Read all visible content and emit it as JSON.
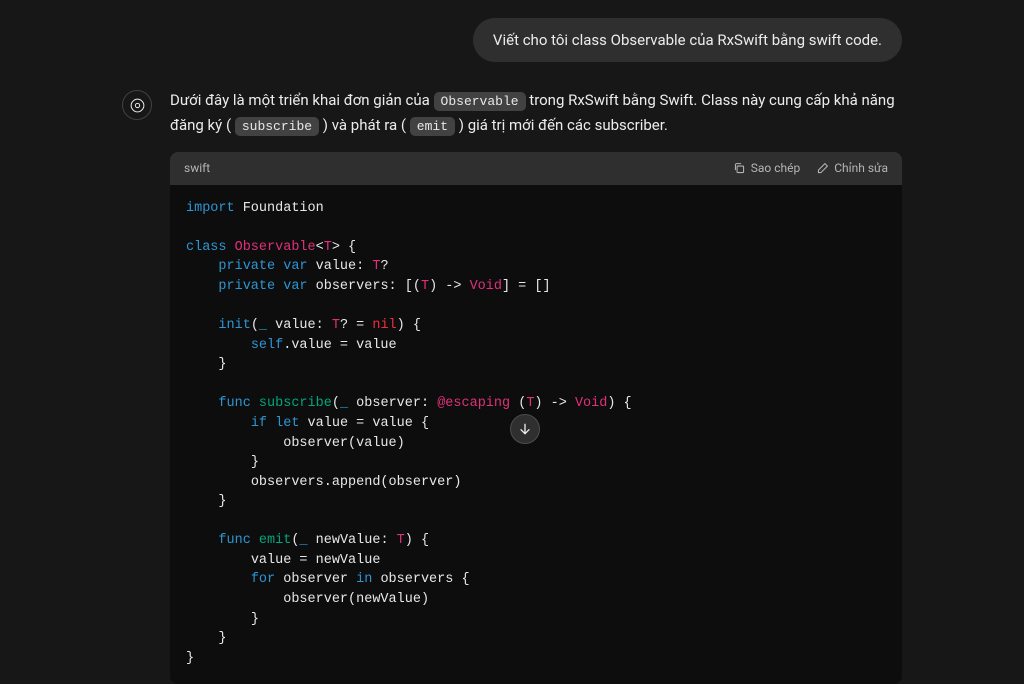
{
  "user": {
    "message": "Viết cho tôi class Observable của RxSwift bằng swift code."
  },
  "assistant": {
    "p1a": "Dưới đây là một triển khai đơn giản của ",
    "p1_code1": "Observable",
    "p1b": " trong RxSwift bằng Swift. Class này cung cấp khả năng đăng ký (",
    "p1_code2": "subscribe",
    "p1c": ") và phát ra (",
    "p1_code3": "emit",
    "p1d": ") giá trị mới đến các subscriber."
  },
  "codeblock": {
    "language": "swift",
    "copy": "Sao chép",
    "edit": "Chỉnh sửa"
  },
  "code": {
    "kw_import": "import",
    "foundation": " Foundation",
    "kw_class": "class ",
    "cls_name": "Observable",
    "generic_open": "<",
    "type_T": "T",
    "generic_close": "> {",
    "kw_private1": "private ",
    "kw_var1": "var",
    "var_value": " value: ",
    "type_T2": "T",
    "opt_brace": "?",
    "kw_private2": "private ",
    "kw_var2": "var",
    "var_observers": " observers: [(",
    "type_T3": "T",
    "obs_mid": ") -> ",
    "type_Void": "Void",
    "obs_end": "] = []",
    "kw_init": "init",
    "init_sig": "(",
    "under1": "_",
    "init_p": " value: ",
    "type_T4": "T",
    "init_opt": "? = ",
    "kw_nil": "nil",
    "init_close": ") {",
    "kw_self": "self",
    "self_assign": ".value = value",
    "brace_c1": "}",
    "kw_func1": "func ",
    "fn_sub": "subscribe",
    "sub_sig": "(",
    "under2": "_",
    "sub_p": " observer: ",
    "kw_esc": "@escaping",
    "sub_mid": " (",
    "type_T5": "T",
    "sub_arrow": ") -> ",
    "type_Void2": "Void",
    "sub_close": ") {",
    "kw_if": "if ",
    "kw_let": "let",
    "if_line": " value = value {",
    "obs_call": "observer(value)",
    "brace_c2": "}",
    "append": "observers.append(observer)",
    "brace_c3": "}",
    "kw_func2": "func ",
    "fn_emit": "emit",
    "emit_sig": "(",
    "under3": "_",
    "emit_p": " newValue: ",
    "type_T6": "T",
    "emit_close": ") {",
    "emit_assign": "value = newValue",
    "kw_for": "for",
    "for_mid": " observer ",
    "kw_in": "in",
    "for_end": " observers {",
    "emit_call": "observer(newValue)",
    "brace_c4": "}",
    "brace_c5": "}",
    "brace_c6": "}"
  }
}
